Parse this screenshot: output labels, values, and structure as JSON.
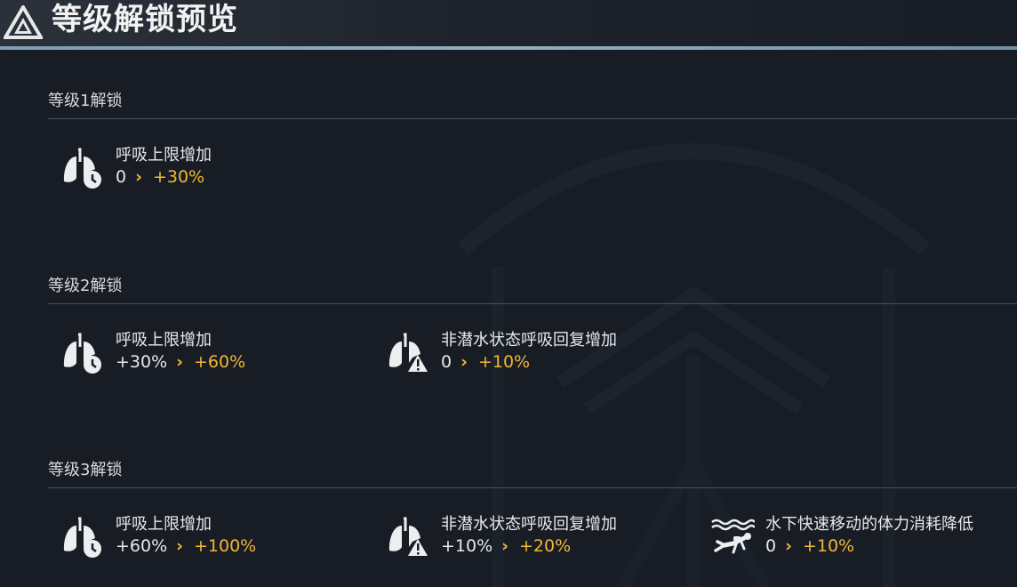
{
  "header": {
    "title": "等级解锁预览"
  },
  "sections": [
    {
      "title": "等级1解锁",
      "items": [
        {
          "icon": "lungs-clock-icon",
          "label": "呼吸上限增加",
          "from": "0",
          "to": "+30%"
        }
      ]
    },
    {
      "title": "等级2解锁",
      "items": [
        {
          "icon": "lungs-clock-icon",
          "label": "呼吸上限增加",
          "from": "+30%",
          "to": "+60%"
        },
        {
          "icon": "lungs-alert-icon",
          "label": "非潜水状态呼吸回复增加",
          "from": "0",
          "to": "+10%"
        }
      ]
    },
    {
      "title": "等级3解锁",
      "items": [
        {
          "icon": "lungs-clock-icon",
          "label": "呼吸上限增加",
          "from": "+60%",
          "to": "+100%"
        },
        {
          "icon": "lungs-alert-icon",
          "label": "非潜水状态呼吸回复增加",
          "from": "+10%",
          "to": "+20%"
        },
        {
          "icon": "swimmer-icon",
          "label": "水下快速移动的体力消耗降低",
          "from": "0",
          "to": "+10%"
        }
      ]
    }
  ],
  "arrow": "›",
  "colors": {
    "accent": "#f2b637",
    "background": "#181d25"
  }
}
